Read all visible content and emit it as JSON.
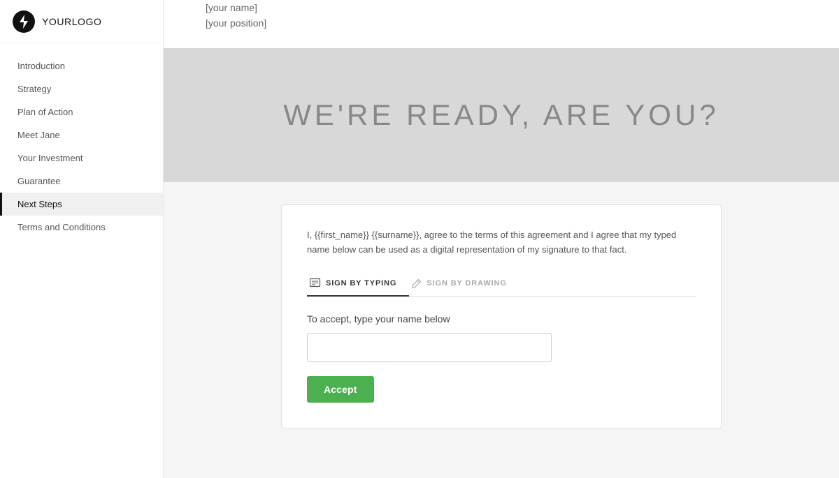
{
  "logo": {
    "icon_label": "lightning-bolt",
    "text_bold": "YOUR",
    "text_light": "LOGO"
  },
  "sidebar": {
    "items": [
      {
        "id": "introduction",
        "label": "Introduction",
        "active": false
      },
      {
        "id": "strategy",
        "label": "Strategy",
        "active": false
      },
      {
        "id": "plan-of-action",
        "label": "Plan of Action",
        "active": false
      },
      {
        "id": "meet-jane",
        "label": "Meet Jane",
        "active": false
      },
      {
        "id": "your-investment",
        "label": "Your Investment",
        "active": false
      },
      {
        "id": "guarantee",
        "label": "Guarantee",
        "active": false
      },
      {
        "id": "next-steps",
        "label": "Next Steps",
        "active": true
      },
      {
        "id": "terms-conditions",
        "label": "Terms and Conditions",
        "active": false
      }
    ]
  },
  "top_partial": {
    "name_placeholder": "[your name]",
    "position_placeholder": "[your position]"
  },
  "hero": {
    "text": "WE'RE READY, ARE YOU?"
  },
  "signature_card": {
    "agreement_text": "I, {{first_name}} {{surname}}, agree to the terms of this agreement and I agree that my typed name below can be used as a digital representation of my signature to that fact.",
    "tab_typing_label": "SIGN BY TYPING",
    "tab_drawing_label": "SIGN BY DRAWING",
    "accept_prompt": "To accept, type your name below",
    "name_input_placeholder": "",
    "accept_button_label": "Accept"
  }
}
